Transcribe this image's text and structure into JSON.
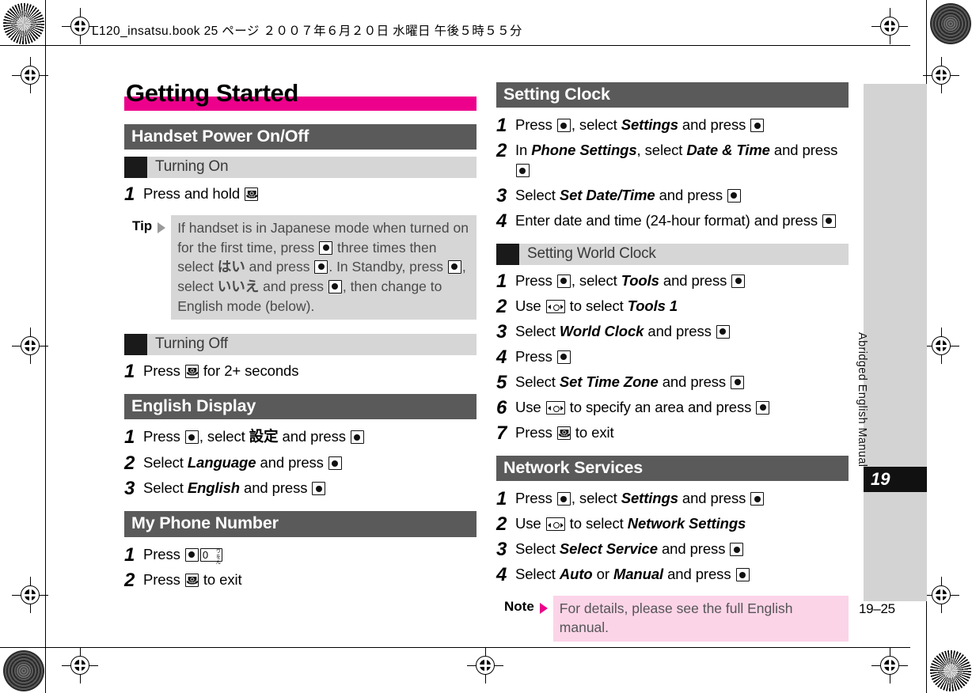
{
  "file_header": "L120_insatsu.book  25 ページ  ２００７年６月２０日   水曜日   午後５時５５分",
  "chapter": {
    "title": "Getting Started",
    "accent_color": "#ec008c",
    "side_label": "Abridged English Manual",
    "number": "19",
    "page_number": "19–25"
  },
  "left_column": {
    "sections": [
      {
        "heading": "Handset Power On/Off",
        "subsections": [
          {
            "heading": "Turning On",
            "steps": [
              {
                "num": "1",
                "parts": [
                  {
                    "t": "text",
                    "v": "Press and hold "
                  },
                  {
                    "t": "key",
                    "v": "power-key"
                  }
                ]
              }
            ],
            "callout": {
              "kind": "tip",
              "label": "Tip",
              "parts": [
                {
                  "t": "text",
                  "v": "If handset is in Japanese mode when turned on for the first time, press "
                },
                {
                  "t": "key",
                  "v": "center-key"
                },
                {
                  "t": "text",
                  "v": " three times then select "
                },
                {
                  "t": "jp",
                  "v": "はい"
                },
                {
                  "t": "text",
                  "v": " and press "
                },
                {
                  "t": "key",
                  "v": "center-key"
                },
                {
                  "t": "text",
                  "v": ". In Standby, press "
                },
                {
                  "t": "key",
                  "v": "center-key"
                },
                {
                  "t": "text",
                  "v": ", select "
                },
                {
                  "t": "jp",
                  "v": "いいえ"
                },
                {
                  "t": "text",
                  "v": " and press "
                },
                {
                  "t": "key",
                  "v": "center-key"
                },
                {
                  "t": "text",
                  "v": ", then change to English mode (below)."
                }
              ]
            }
          },
          {
            "heading": "Turning Off",
            "steps": [
              {
                "num": "1",
                "parts": [
                  {
                    "t": "text",
                    "v": "Press "
                  },
                  {
                    "t": "key",
                    "v": "power-key"
                  },
                  {
                    "t": "text",
                    "v": " for 2+ seconds"
                  }
                ]
              }
            ]
          }
        ]
      },
      {
        "heading": "English Display",
        "steps": [
          {
            "num": "1",
            "parts": [
              {
                "t": "text",
                "v": "Press "
              },
              {
                "t": "key",
                "v": "center-key"
              },
              {
                "t": "text",
                "v": ", select "
              },
              {
                "t": "jp",
                "v": "設定"
              },
              {
                "t": "text",
                "v": " and press "
              },
              {
                "t": "key",
                "v": "center-key"
              }
            ]
          },
          {
            "num": "2",
            "parts": [
              {
                "t": "text",
                "v": "Select "
              },
              {
                "t": "ital",
                "v": "Language"
              },
              {
                "t": "text",
                "v": " and press "
              },
              {
                "t": "key",
                "v": "center-key"
              }
            ]
          },
          {
            "num": "3",
            "parts": [
              {
                "t": "text",
                "v": "Select "
              },
              {
                "t": "ital",
                "v": "English"
              },
              {
                "t": "text",
                "v": " and press "
              },
              {
                "t": "key",
                "v": "center-key"
              }
            ]
          }
        ]
      },
      {
        "heading": "My Phone Number",
        "steps": [
          {
            "num": "1",
            "parts": [
              {
                "t": "text",
                "v": "Press "
              },
              {
                "t": "key",
                "v": "center-key"
              },
              {
                "t": "key",
                "v": "zero-key"
              }
            ]
          },
          {
            "num": "2",
            "parts": [
              {
                "t": "text",
                "v": "Press "
              },
              {
                "t": "key",
                "v": "power-key"
              },
              {
                "t": "text",
                "v": " to exit"
              }
            ]
          }
        ]
      }
    ]
  },
  "right_column": {
    "sections": [
      {
        "heading": "Setting Clock",
        "steps": [
          {
            "num": "1",
            "parts": [
              {
                "t": "text",
                "v": "Press "
              },
              {
                "t": "key",
                "v": "center-key"
              },
              {
                "t": "text",
                "v": ", select "
              },
              {
                "t": "ital",
                "v": "Settings"
              },
              {
                "t": "text",
                "v": " and press "
              },
              {
                "t": "key",
                "v": "center-key"
              }
            ]
          },
          {
            "num": "2",
            "parts": [
              {
                "t": "text",
                "v": "In "
              },
              {
                "t": "ital",
                "v": "Phone Settings"
              },
              {
                "t": "text",
                "v": ", select "
              },
              {
                "t": "ital",
                "v": "Date & Time"
              },
              {
                "t": "text",
                "v": " and press "
              },
              {
                "t": "key",
                "v": "center-key"
              }
            ]
          },
          {
            "num": "3",
            "parts": [
              {
                "t": "text",
                "v": "Select "
              },
              {
                "t": "ital",
                "v": "Set Date/Time"
              },
              {
                "t": "text",
                "v": " and press "
              },
              {
                "t": "key",
                "v": "center-key"
              }
            ]
          },
          {
            "num": "4",
            "parts": [
              {
                "t": "text",
                "v": "Enter date and time (24-hour format) and press "
              },
              {
                "t": "key",
                "v": "center-key"
              }
            ]
          }
        ]
      },
      {
        "sub_heading": "Setting World Clock",
        "steps": [
          {
            "num": "1",
            "parts": [
              {
                "t": "text",
                "v": "Press "
              },
              {
                "t": "key",
                "v": "center-key"
              },
              {
                "t": "text",
                "v": ", select "
              },
              {
                "t": "ital",
                "v": "Tools"
              },
              {
                "t": "text",
                "v": " and press "
              },
              {
                "t": "key",
                "v": "center-key"
              }
            ]
          },
          {
            "num": "2",
            "parts": [
              {
                "t": "text",
                "v": "Use "
              },
              {
                "t": "key",
                "v": "nav-key"
              },
              {
                "t": "text",
                "v": " to select "
              },
              {
                "t": "ital",
                "v": "Tools 1"
              }
            ]
          },
          {
            "num": "3",
            "parts": [
              {
                "t": "text",
                "v": "Select "
              },
              {
                "t": "ital",
                "v": "World Clock"
              },
              {
                "t": "text",
                "v": " and press "
              },
              {
                "t": "key",
                "v": "center-key"
              }
            ]
          },
          {
            "num": "4",
            "parts": [
              {
                "t": "text",
                "v": "Press "
              },
              {
                "t": "key",
                "v": "center-key"
              }
            ]
          },
          {
            "num": "5",
            "parts": [
              {
                "t": "text",
                "v": "Select "
              },
              {
                "t": "ital",
                "v": "Set Time Zone"
              },
              {
                "t": "text",
                "v": " and press "
              },
              {
                "t": "key",
                "v": "center-key"
              }
            ]
          },
          {
            "num": "6",
            "parts": [
              {
                "t": "text",
                "v": "Use "
              },
              {
                "t": "key",
                "v": "nav-key"
              },
              {
                "t": "text",
                "v": " to specify an area and press "
              },
              {
                "t": "key",
                "v": "center-key"
              }
            ]
          },
          {
            "num": "7",
            "parts": [
              {
                "t": "text",
                "v": "Press "
              },
              {
                "t": "key",
                "v": "power-key"
              },
              {
                "t": "text",
                "v": " to exit"
              }
            ]
          }
        ]
      },
      {
        "heading": "Network Services",
        "steps": [
          {
            "num": "1",
            "parts": [
              {
                "t": "text",
                "v": "Press "
              },
              {
                "t": "key",
                "v": "center-key"
              },
              {
                "t": "text",
                "v": ", select "
              },
              {
                "t": "ital",
                "v": "Settings"
              },
              {
                "t": "text",
                "v": " and press "
              },
              {
                "t": "key",
                "v": "center-key"
              }
            ]
          },
          {
            "num": "2",
            "parts": [
              {
                "t": "text",
                "v": "Use "
              },
              {
                "t": "key",
                "v": "nav-key"
              },
              {
                "t": "text",
                "v": " to select "
              },
              {
                "t": "ital",
                "v": "Network Settings"
              }
            ]
          },
          {
            "num": "3",
            "parts": [
              {
                "t": "text",
                "v": "Select "
              },
              {
                "t": "ital",
                "v": "Select Service"
              },
              {
                "t": "text",
                "v": " and press "
              },
              {
                "t": "key",
                "v": "center-key"
              }
            ]
          },
          {
            "num": "4",
            "parts": [
              {
                "t": "text",
                "v": "Select "
              },
              {
                "t": "ital",
                "v": "Auto"
              },
              {
                "t": "text",
                "v": " or "
              },
              {
                "t": "ital",
                "v": "Manual"
              },
              {
                "t": "text",
                "v": " and press "
              },
              {
                "t": "key",
                "v": "center-key"
              }
            ]
          }
        ],
        "callout": {
          "kind": "note",
          "label": "Note",
          "parts": [
            {
              "t": "text",
              "v": "For details, please see the full English manual."
            }
          ]
        }
      }
    ]
  },
  "key_glyphs": {
    "center-key": "center-select-key",
    "power-key": "power-end-key",
    "nav-key": "navigation-left-right-key",
    "zero-key": "zero-key",
    "zero_digit": "0",
    "zero_jp_top": "ワ",
    "zero_jp_mid": "を",
    "zero_jp_bot": "ん"
  }
}
